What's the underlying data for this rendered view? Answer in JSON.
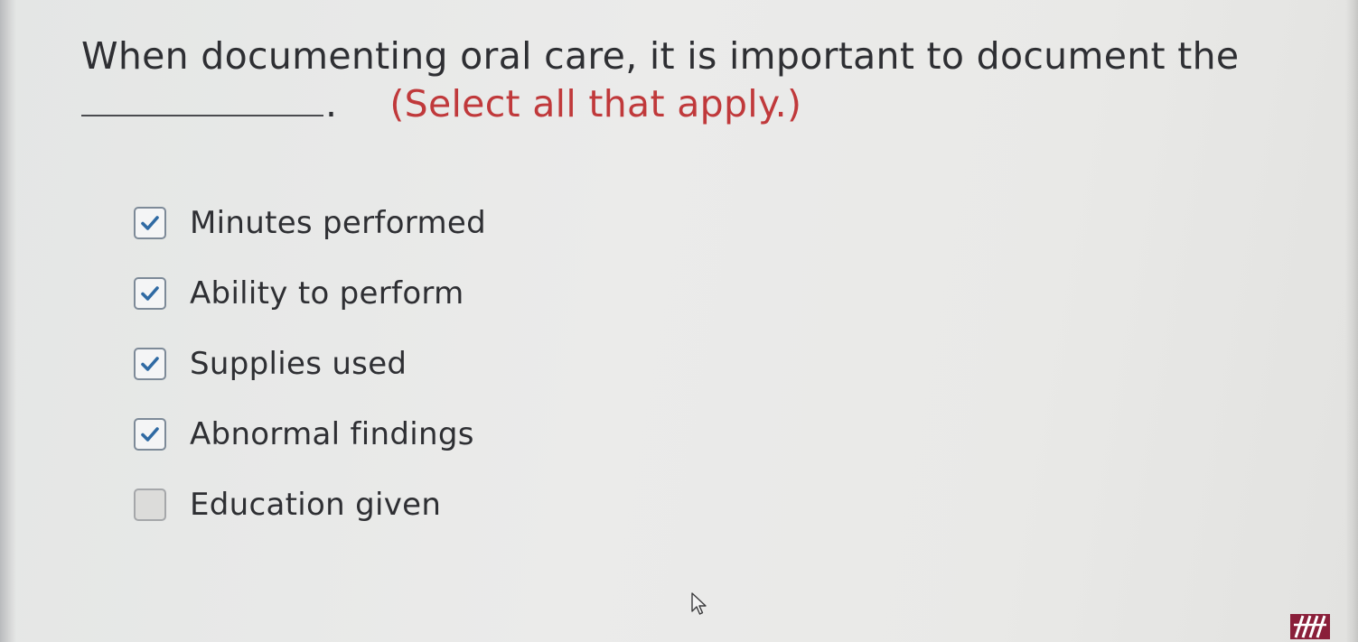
{
  "question": {
    "text": "When documenting oral care, it is important to document the",
    "period": ".",
    "instruction": "(Select all that apply.)"
  },
  "options": [
    {
      "label": "Minutes performed",
      "checked": true
    },
    {
      "label": "Ability to perform",
      "checked": true
    },
    {
      "label": "Supplies used",
      "checked": true
    },
    {
      "label": "Abnormal findings",
      "checked": true
    },
    {
      "label": "Education given",
      "checked": false
    }
  ],
  "icons": {
    "checkmark": "checkmark-icon",
    "cursor": "mouse-pointer-icon",
    "logo": "publisher-logo-icon"
  },
  "colors": {
    "text": "#2e2f33",
    "instruction": "#c0393b",
    "checkmark": "#2f6aa3",
    "logo": "#8a1f3a"
  }
}
